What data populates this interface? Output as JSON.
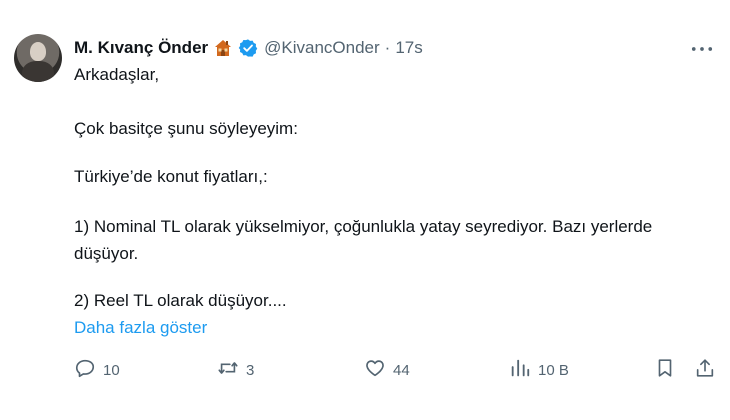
{
  "author": {
    "name": "M. Kıvanç Önder",
    "handle": "@KivancOnder",
    "separator": "·",
    "time": "17s"
  },
  "tweet": {
    "lines": [
      "Arkadaşlar,",
      "Çok basitçe şunu söyleyeyim:",
      "Türkiye’de konut fiyatları,:",
      "1) Nominal TL olarak yükselmiyor, çoğunlukla yatay seyrediyor. Bazı yerlerde",
      "düşüyor.",
      "2) Reel TL olarak düşüyor...."
    ],
    "show_more": "Daha fazla göster"
  },
  "actions": {
    "replies": "10",
    "retweets": "3",
    "likes": "44",
    "views": "10 B"
  },
  "icons": {
    "emoji": "house-icon",
    "verified": "verified-badge-icon",
    "more": "more-icon",
    "reply": "reply-icon",
    "retweet": "retweet-icon",
    "like": "heart-icon",
    "views": "views-icon",
    "bookmark": "bookmark-icon",
    "share": "share-icon"
  },
  "colors": {
    "accent": "#1d9bf0",
    "muted": "#536471",
    "text": "#0f1419"
  }
}
